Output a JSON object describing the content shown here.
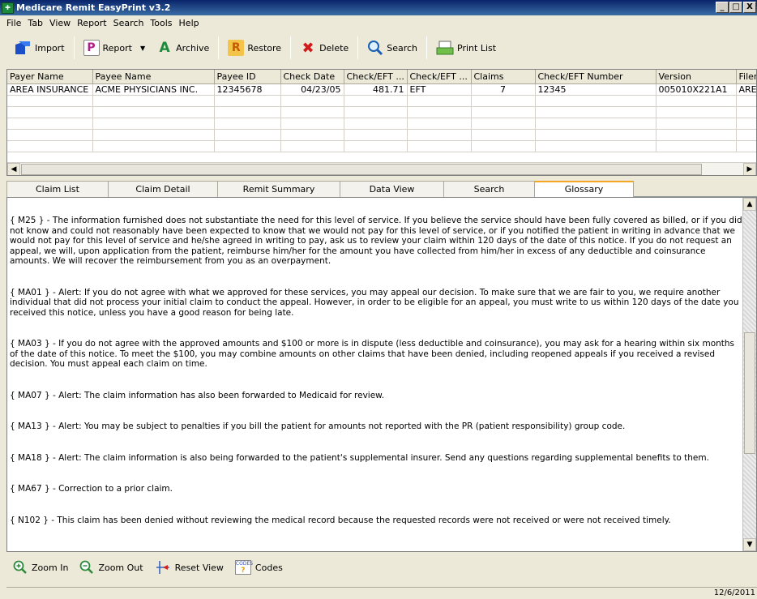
{
  "window": {
    "title": "Medicare Remit EasyPrint v3.2",
    "minimize": "_",
    "maximize": "□",
    "close": "X"
  },
  "menu": [
    "File",
    "Tab",
    "View",
    "Report",
    "Search",
    "Tools",
    "Help"
  ],
  "toolbar": {
    "import": "Import",
    "report": "Report",
    "archive": "Archive",
    "restore": "Restore",
    "delete": "Delete",
    "search": "Search",
    "print_list": "Print List"
  },
  "grid": {
    "headers": [
      "Payer Name",
      "Payee Name",
      "Payee ID",
      "Check Date",
      "Check/EFT ...",
      "Check/EFT ...",
      "Claims",
      "Check/EFT Number",
      "Version",
      "Filena"
    ],
    "rows": [
      [
        "AREA INSURANCE",
        "ACME PHYSICIANS INC.",
        "12345678",
        "04/23/05",
        "481.71",
        "EFT",
        "7",
        "12345",
        "005010X221A1",
        "AREA"
      ]
    ]
  },
  "tabs": [
    "Claim List",
    "Claim Detail",
    "Remit Summary",
    "Data View",
    "Search",
    "Glossary"
  ],
  "active_tab": "Glossary",
  "glossary": [
    "{ M25 } - The information furnished does not substantiate the need for this level of service. If you believe the service should have been fully covered as billed, or if you did not know and could not reasonably have been expected to know that we would not pay for this level of service, or if you notified the patient in writing in advance that we would not pay for this level of service and he/she agreed in writing to pay, ask us to review your claim within 120 days of the date of this notice.  If you do not request an appeal, we will, upon application from the patient, reimburse him/her for the amount you have collected from him/her in excess of any deductible and coinsurance amounts. We will recover the reimbursement from you as an overpayment.",
    "{ MA01 } - Alert: If you do not agree with what we approved for these services, you may appeal our decision.  To make sure that we are fair to you, we require another individual that did not process your initial claim to conduct the appeal.  However, in order to be eligible for an appeal, you must write to us within 120 days of the date you received this notice, unless you have a good reason for being late.",
    "{ MA03 } - If you do not agree with the approved amounts and $100 or more is in dispute (less deductible and coinsurance), you may ask for a hearing within six months of the date of this notice. To meet the $100, you may combine amounts on other claims that have been denied, including reopened appeals if you received a revised decision. You must appeal each claim on time.",
    "{ MA07 } - Alert: The claim information has also been forwarded to Medicaid for review.",
    "{ MA13 } - Alert: You may be subject to penalties if you bill the patient for amounts not reported with the PR (patient responsibility) group code.",
    "{ MA18 } - Alert: The claim information is also being forwarded to the patient's supplemental insurer. Send any questions regarding supplemental benefits to them.",
    "{ MA67 } - Correction to a prior claim.",
    "{ N102 } - This claim has been denied without reviewing the medical record because the requested records were not received or were not received timely."
  ],
  "bottom_toolbar": {
    "zoom_in": "Zoom In",
    "zoom_out": "Zoom Out",
    "reset_view": "Reset View",
    "codes": "Codes",
    "codes_icon_text": "CODES"
  },
  "status": {
    "date": "12/6/2011"
  }
}
